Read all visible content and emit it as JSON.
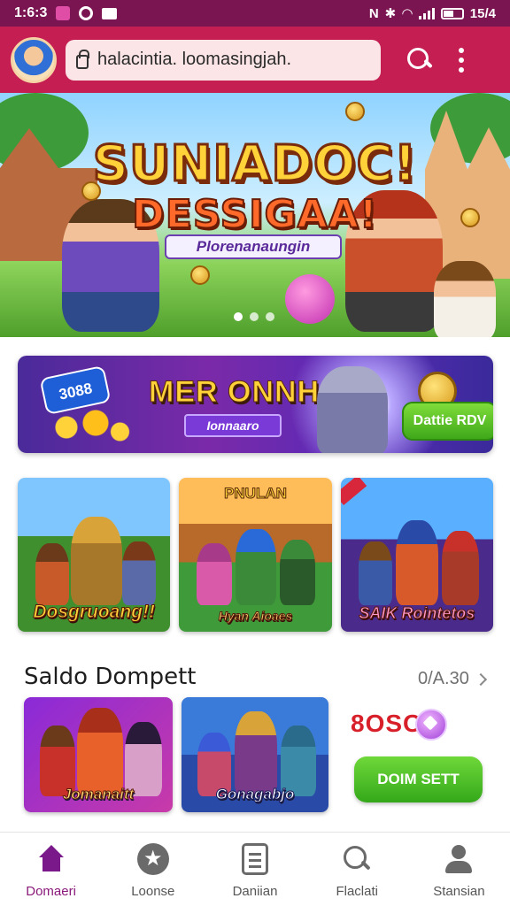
{
  "status_bar": {
    "time": "1:6:3",
    "right_text": "15/4",
    "icons": [
      "gallery-icon",
      "vpn-icon",
      "message-icon",
      "nfc-icon",
      "bluetooth-icon",
      "wifi-icon",
      "signal-icon",
      "battery-icon"
    ]
  },
  "top_bar": {
    "url": "halacintia. loomasingjah.",
    "icons": [
      "avatar",
      "lock-icon",
      "search-icon",
      "more-vert-icon"
    ]
  },
  "hero": {
    "title_line1": "SUNIADOC!",
    "title_line2": "DESSIGAA!",
    "subtitle": "Plorenanaungin",
    "slide_count": 3
  },
  "promo": {
    "badge": "3088",
    "title": "MER ONNH",
    "tag": "Ionnaaro",
    "button": "Dattie RDV"
  },
  "game_cards": [
    {
      "caption": "Dosgruoang!!",
      "top_caption": ""
    },
    {
      "caption": "Hyan Aioaes",
      "top_caption": "PNULAN"
    },
    {
      "caption": "SAIK Rointetos",
      "top_caption": ""
    }
  ],
  "wallet": {
    "title": "Saldo Dompett",
    "link": "0/A.30",
    "balance": "8OSO",
    "button": "DOIM SETT",
    "cards": [
      {
        "caption": "Jomanaitt"
      },
      {
        "caption": "Gonagabjo"
      }
    ]
  },
  "bottom_nav": [
    {
      "label": "Domaeri",
      "icon": "home-icon",
      "active": true
    },
    {
      "label": "Loonse",
      "icon": "star-icon",
      "active": false
    },
    {
      "label": "Daniian",
      "icon": "document-icon",
      "active": false
    },
    {
      "label": "Flaclati",
      "icon": "search-icon",
      "active": false
    },
    {
      "label": "Stansian",
      "icon": "person-icon",
      "active": false
    }
  ],
  "colors": {
    "topbar": "#c41e52",
    "statusbar": "#7a1552",
    "accent_green": "#4cbf24",
    "active_nav": "#7a1a8a",
    "balance": "#d8202a"
  }
}
